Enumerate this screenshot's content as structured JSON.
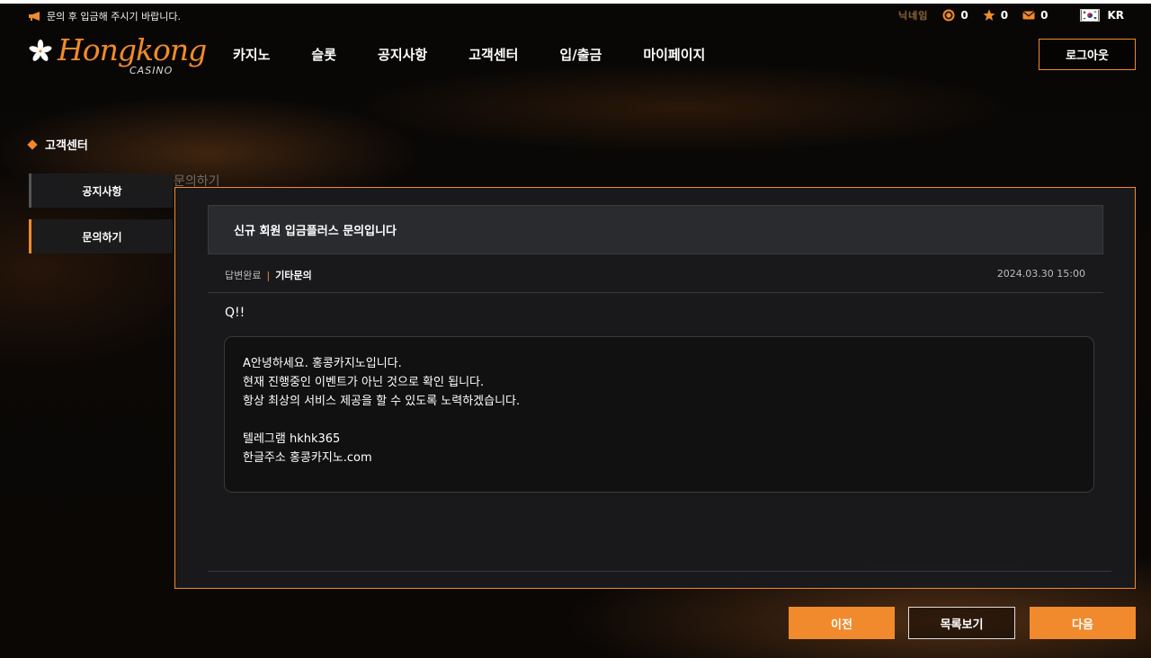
{
  "topbar": {
    "notice": "문의 후 입금해 주시기 바랍니다.",
    "nickname": "닉네임",
    "coin": "0",
    "point": "0",
    "mail": "0",
    "lang": "KR"
  },
  "header": {
    "logo_name": "Hongkong",
    "logo_sub": "CASINO",
    "nav": [
      "카지노",
      "슬롯",
      "공지사항",
      "고객센터",
      "입/출금",
      "마이페이지"
    ],
    "logout_label": "로그아웃"
  },
  "sidebar": {
    "title": "고객센터",
    "items": [
      {
        "label": "공지사항",
        "active": false
      },
      {
        "label": "문의하기",
        "active": true
      }
    ]
  },
  "breadcrumb": "문의하기",
  "inquiry": {
    "title": "신규 회원 입금플러스 문의입니다",
    "status": "답변완료",
    "separator": "|",
    "category": "기타문의",
    "date": "2024.03.30 15:00",
    "question": "Q!!",
    "answer_lines": [
      "A안녕하세요. 홍콩카지노입니다.",
      "현재 진행중인 이벤트가 아닌 것으로 확인 됩니다.",
      "항상 최상의 서비스 제공을 할 수 있도록 노력하겠습니다.",
      "",
      "텔레그램 hkhk365",
      "한글주소 홍콩카지노.com"
    ]
  },
  "buttons": {
    "prev": "이전",
    "list": "목록보기",
    "next": "다음"
  },
  "colors": {
    "accent": "#f08a2c",
    "panel": "#1a1a1c",
    "title_bar": "#2a2b2e"
  }
}
